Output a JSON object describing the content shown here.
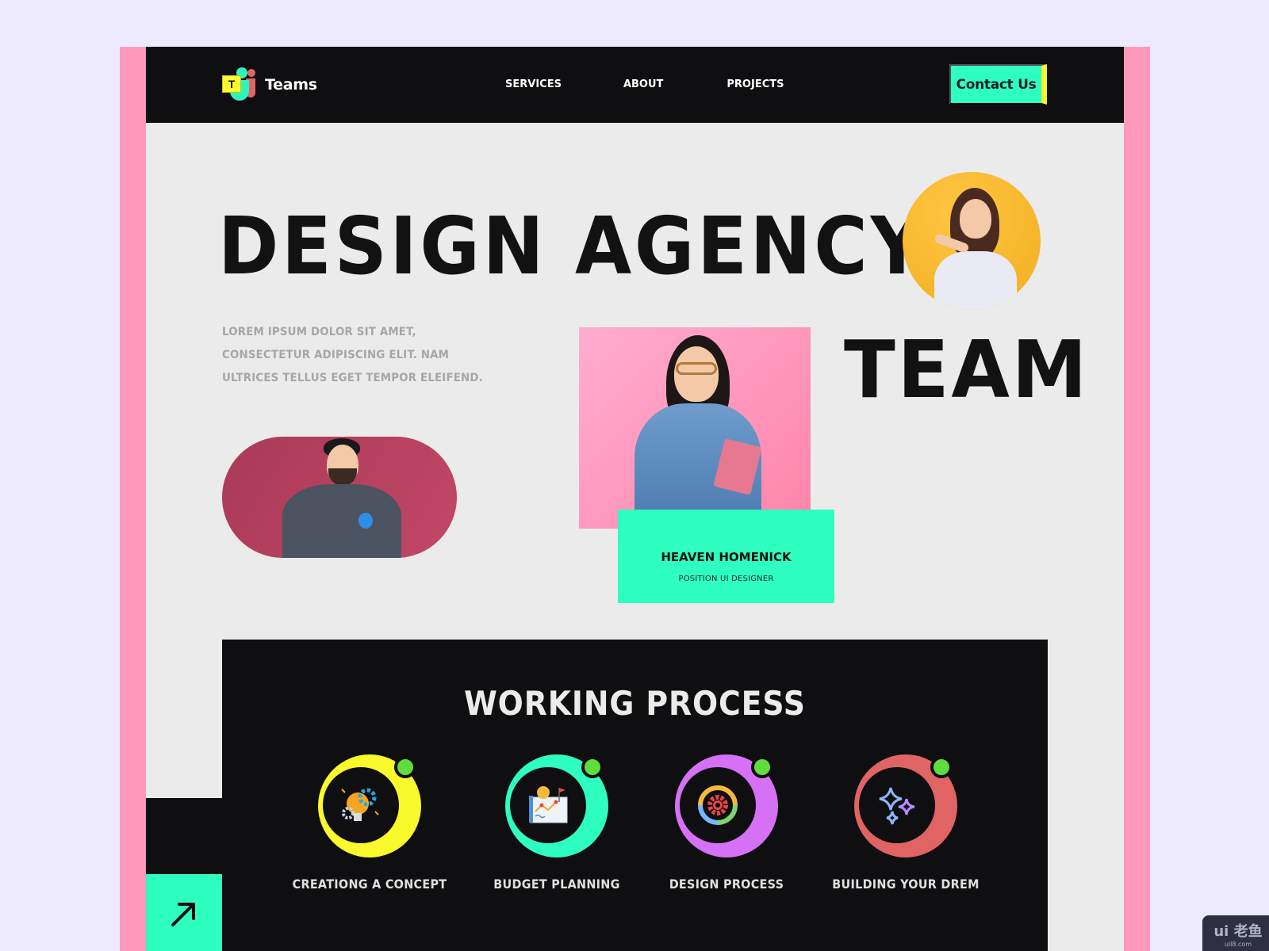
{
  "colors": {
    "background": "#ede9fe",
    "frame_pink": "#ff99bb",
    "page_bg": "#ebebeb",
    "dark": "#0f0e10",
    "accent_teal": "#2effc0",
    "accent_yellow": "#f7f72e",
    "step_dot_green": "#5fdd3c"
  },
  "nav": {
    "logo_letter": "T",
    "logo_text": "Teams",
    "links": [
      {
        "label": "SERVICES"
      },
      {
        "label": "ABOUT"
      },
      {
        "label": "PROJECTS"
      }
    ],
    "cta_label": "Contact Us"
  },
  "hero": {
    "title_line1": "DESIGN  AGENCY",
    "title_line2": "TEAM",
    "description": "LOREM IPSUM DOLOR SIT AMET, CONSECTETUR ADIPISCING ELIT. NAM ULTRICES TELLUS EGET TEMPOR ELEIFEND.",
    "photos": [
      {
        "name": "woman-pointing-photo",
        "bg": "#f5b52a"
      },
      {
        "name": "woman-tablet-photo",
        "bg": "#ff95b8"
      },
      {
        "name": "man-globe-photo",
        "bg": "#b5405e"
      }
    ],
    "featured_member": {
      "name": "HEAVEN HOMENICK",
      "role": "POSITION UI DESIGNER"
    }
  },
  "process": {
    "title": "WORKING PROCESS",
    "steps": [
      {
        "label": "CREATIONG A CONCEPT",
        "icon": "lightbulb-gears-icon",
        "ring_color": "#f9f92b"
      },
      {
        "label": "BUDGET PLANNING",
        "icon": "planning-chart-icon",
        "ring_color": "#2effc0"
      },
      {
        "label": "DESIGN PROCESS",
        "icon": "gear-cycle-icon",
        "ring_color": "#d671f6"
      },
      {
        "label": "BUILDING YOUR DREM",
        "icon": "sparkles-icon",
        "ring_color": "#e06464"
      }
    ],
    "arrow_icon": "arrow-up-right-icon"
  },
  "watermark": {
    "text": "ui 老鱼",
    "url_text": "uil8.com"
  }
}
